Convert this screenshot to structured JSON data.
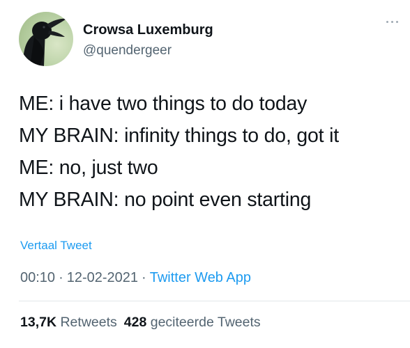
{
  "author": {
    "display_name": "Crowsa Luxemburg",
    "handle": "@quendergeer"
  },
  "tweet": {
    "lines": [
      "ME: i have two things to do today",
      "MY BRAIN: infinity things to do, got it",
      "ME: no, just two",
      "MY BRAIN: no point even starting"
    ],
    "translate_label": "Vertaal Tweet",
    "time": "00:10",
    "date": "12-02-2021",
    "source": "Twitter Web App",
    "separator": "·"
  },
  "stats": {
    "retweets_count": "13,7K",
    "retweets_label": "Retweets",
    "quotes_count": "428",
    "quotes_label": "geciteerde Tweets"
  },
  "icons": {
    "more": "more-horizontal-icon",
    "avatar": "crow-avatar"
  },
  "colors": {
    "link": "#1d9bf0",
    "secondary_text": "#536471",
    "primary_text": "#0f1419"
  }
}
